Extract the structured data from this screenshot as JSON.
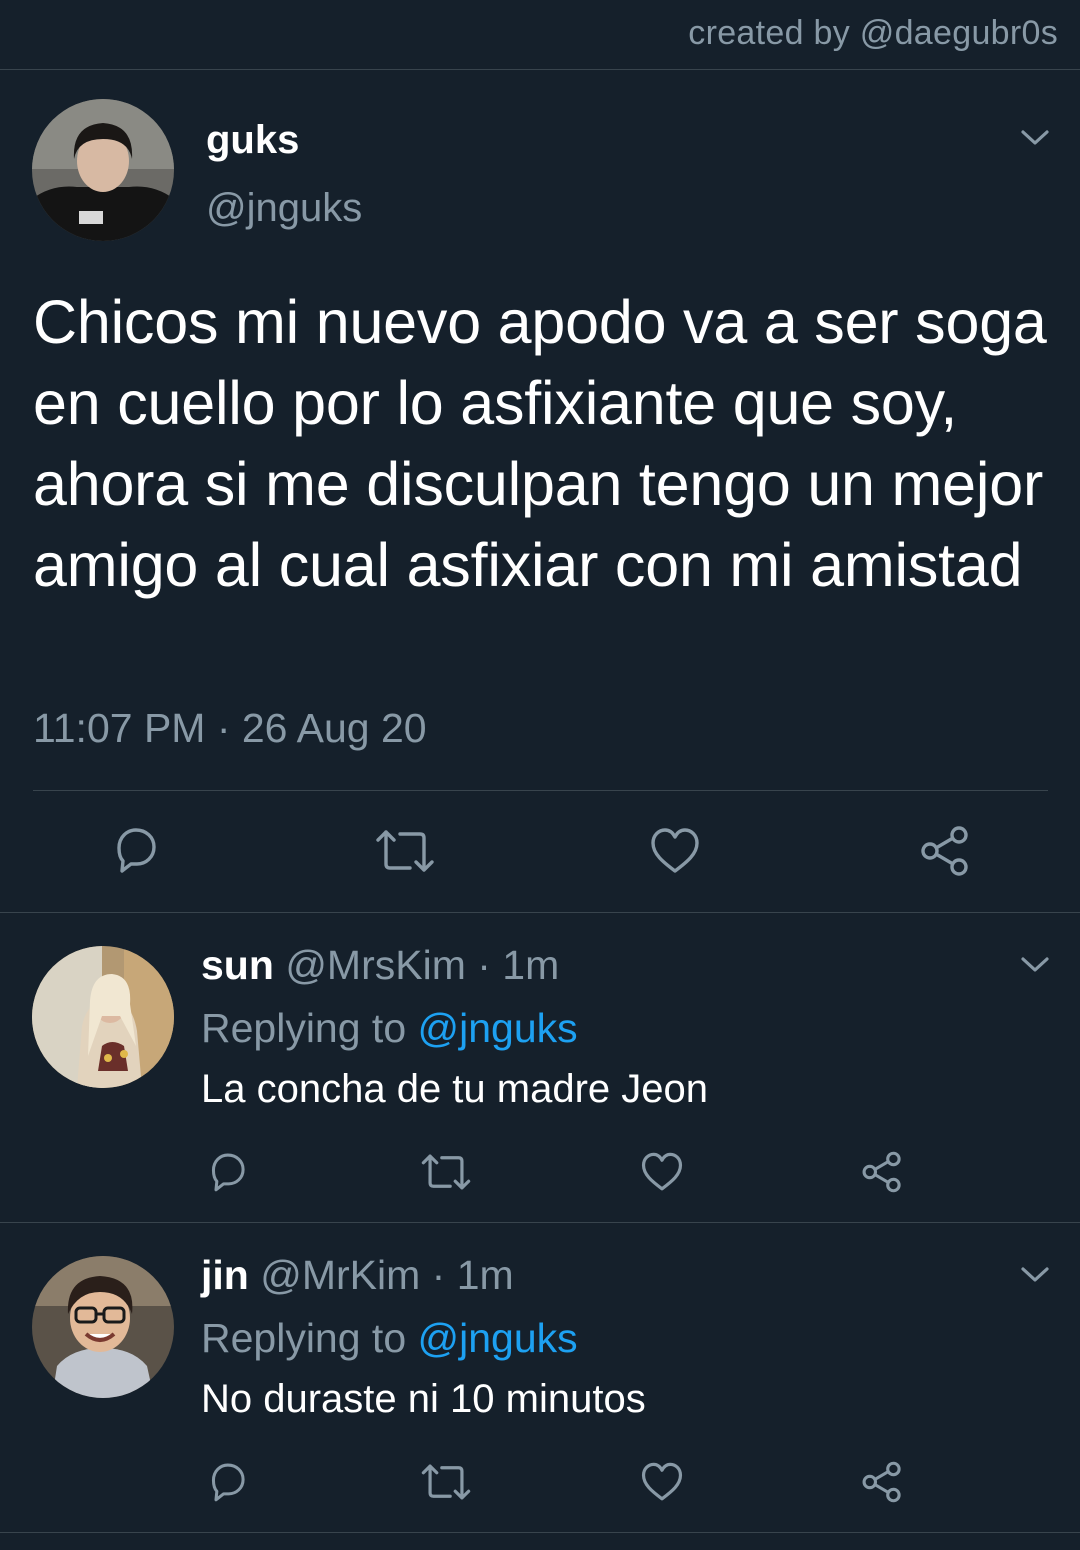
{
  "credit": "created by @daegubr0s",
  "tweet": {
    "name": "guks",
    "handle": "@jnguks",
    "text": "Chicos mi nuevo apodo va a ser soga en cuello por lo asfixiante que soy, ahora si me disculpan tengo un mejor amigo al cual asfixiar con mi amistad",
    "timestamp": "11:07 PM · 26 Aug 20"
  },
  "replies": [
    {
      "name": "sun",
      "handle": "@MrsKim",
      "sep": " · ",
      "time": "1m",
      "replying_label": "Replying to ",
      "mention": "@jnguks",
      "text": "La concha de tu madre Jeon"
    },
    {
      "name": "jin",
      "handle": "@MrKim",
      "sep": " · ",
      "time": "1m",
      "replying_label": "Replying to ",
      "mention": "@jnguks",
      "text": "No duraste ni 10 minutos"
    }
  ],
  "icons": [
    "chevron-down-icon",
    "reply-icon",
    "retweet-icon",
    "like-icon",
    "share-icon"
  ],
  "colors": {
    "background": "#15202b",
    "text": "#ffffff",
    "secondary": "#8899a6",
    "link": "#1da1f2",
    "divider": "#38444d"
  }
}
